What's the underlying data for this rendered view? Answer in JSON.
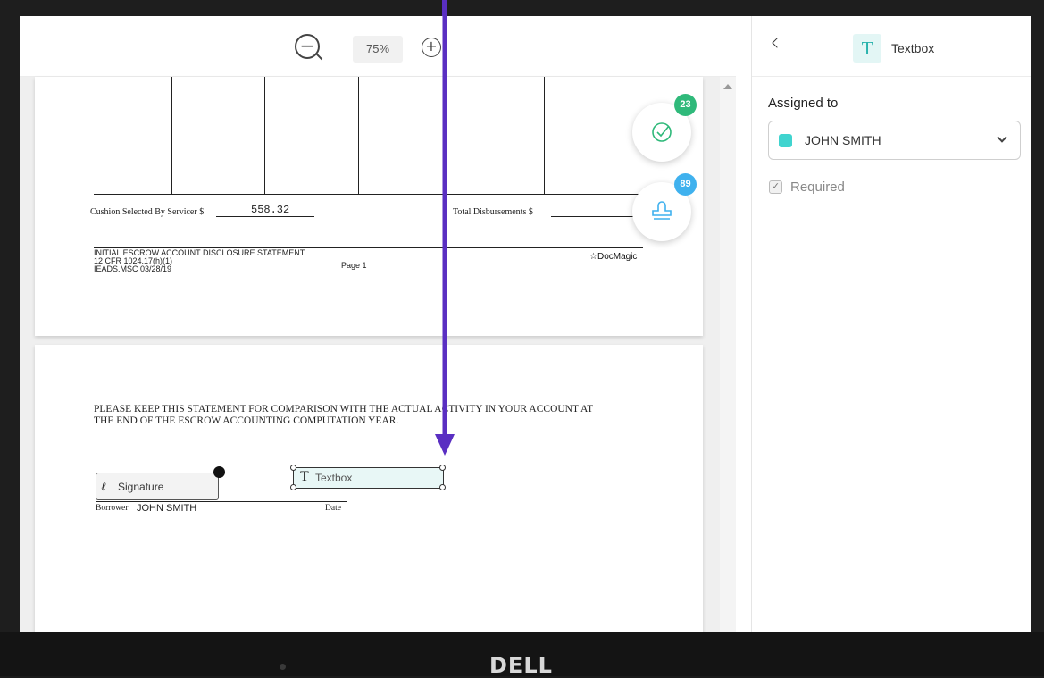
{
  "viewer": {
    "zoom_out_glyph": "−",
    "zoom_in_glyph": "+",
    "zoom_level": "75%",
    "check_badge_count": "23",
    "stamp_badge_count": "89",
    "badge_colors": {
      "check": "#2fb97a",
      "stamp": "#3fb1ee"
    }
  },
  "page1": {
    "cushion_label": "Cushion Selected By Servicer $",
    "cushion_value": "558.32",
    "total_disb_label": "Total Disbursements $",
    "footer_line1": "INITIAL ESCROW ACCOUNT DISCLOSURE STATEMENT",
    "footer_line2": "12 CFR 1024.17(h)(1)",
    "footer_line3": "IEADS.MSC  03/28/19",
    "page_label": "Page 1",
    "logo": "DocMagic"
  },
  "page2": {
    "statement_line1": "PLEASE KEEP THIS STATEMENT FOR COMPARISON WITH  THE ACTUAL ACTIVITY IN YOUR ACCOUNT AT",
    "statement_line2": "THE END OF THE ESCROW ACCOUNTING COMPUTATION YEAR.",
    "signature_field": "Signature",
    "textbox_field": "Textbox",
    "borrower_label": "Borrower",
    "borrower_name": "JOHN SMITH",
    "date_label": "Date"
  },
  "panel": {
    "icon_glyph": "T",
    "title": "Textbox",
    "assigned_label": "Assigned to",
    "assignee": "JOHN SMITH",
    "assignee_color": "#40d4cf",
    "required_label": "Required",
    "required_checked": true
  },
  "device": {
    "brand": "DELL"
  },
  "annotation": {
    "arrow_color": "#5a2fc2"
  }
}
